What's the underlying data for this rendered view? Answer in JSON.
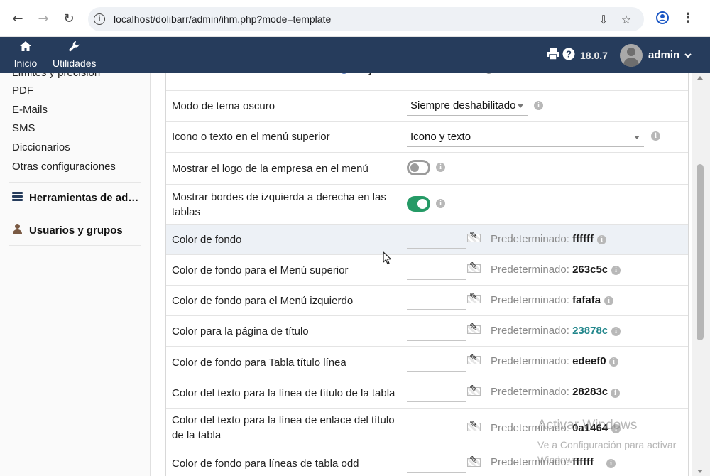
{
  "browser": {
    "url": "localhost/dolibarr/admin/ihm.php?mode=template"
  },
  "topbar": {
    "menu": [
      {
        "label": "Inicio",
        "icon": "home-icon"
      },
      {
        "label": "Utilidades",
        "icon": "wrench-icon"
      }
    ],
    "version": "18.0.7",
    "user": "admin"
  },
  "sidebar": {
    "partial_top": "Límites y precisión",
    "links": [
      "PDF",
      "E-Mails",
      "SMS",
      "Diccionarios",
      "Otras configuraciones"
    ],
    "sections": [
      {
        "label": "Herramientas de administración",
        "icon": "tools-icon"
      },
      {
        "label": "Usuarios y grupos",
        "icon": "user-icon"
      }
    ]
  },
  "main": {
    "partial_top": {
      "opt1": "eldy",
      "opt2": "md"
    },
    "dark_mode": {
      "label": "Modo de tema oscuro",
      "value": "Siempre deshabilitado"
    },
    "top_menu": {
      "label": "Icono o texto en el menú superior",
      "value": "Icono y texto"
    },
    "show_logo": {
      "label": "Mostrar el logo de la empresa en el menú",
      "enabled": false
    },
    "borders": {
      "label": "Mostrar bordes de izquierda a derecha en las tablas",
      "enabled": true
    },
    "default_prefix": "Predeterminado:",
    "colors": [
      {
        "label": "Color de fondo",
        "default": "ffffff"
      },
      {
        "label": "Color de fondo para el Menú superior",
        "default": "263c5c"
      },
      {
        "label": "Color de fondo para el Menú izquierdo",
        "default": "fafafa"
      },
      {
        "label": "Color para la página de título",
        "default": "23878c",
        "accent": "#23878c"
      },
      {
        "label": "Color de fondo para Tabla título línea",
        "default": "edeef0"
      },
      {
        "label": "Color del texto para la línea de título de la tabla",
        "default": "28283c"
      },
      {
        "label": "Color del texto para la línea de enlace del título de la tabla",
        "default": "0a1464"
      },
      {
        "label": "Color de fondo para líneas de tabla odd",
        "default": "ffffff"
      }
    ]
  },
  "watermark": {
    "title": "Activar Windows",
    "subtitle": "Ve a Configuración para activar Windows."
  },
  "theme": {
    "topbar_color": "#263c5c",
    "toggle_on_color": "#259a66",
    "accent_color": "#23878c"
  }
}
